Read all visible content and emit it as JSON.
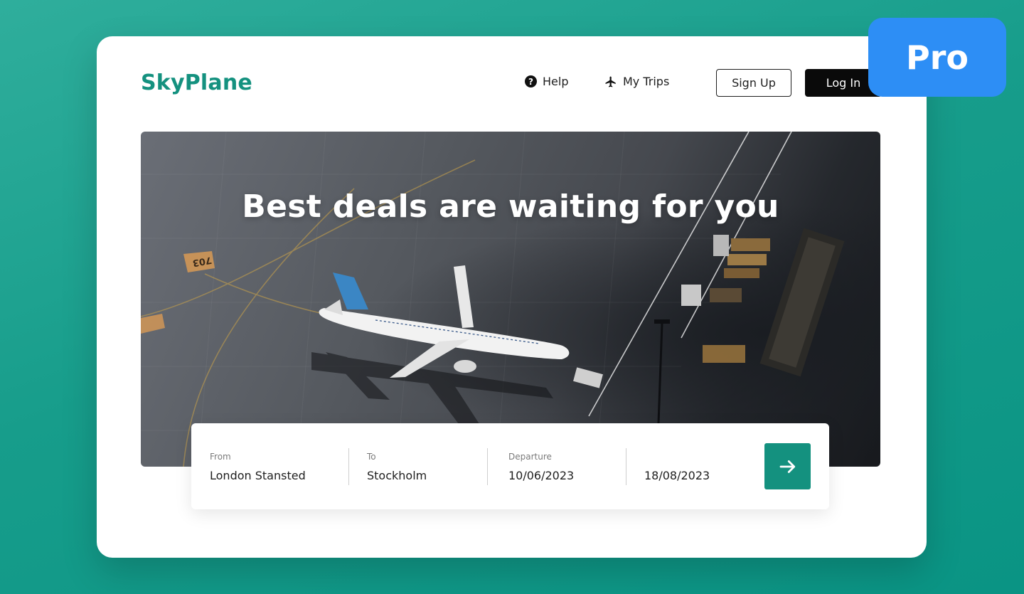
{
  "brand": {
    "name": "SkyPlane",
    "color": "#14917f"
  },
  "nav": {
    "help": {
      "label": "Help",
      "icon": "question-circle-icon"
    },
    "trips": {
      "label": "My Trips",
      "icon": "airplane-icon"
    },
    "sign_up": "Sign Up",
    "log_in": "Log In"
  },
  "hero": {
    "title": "Best deals are waiting for you",
    "image": "aerial-airport-with-airplane-photo",
    "stand_number": "703"
  },
  "search": {
    "from": {
      "label": "From",
      "value": "London Stansted"
    },
    "to": {
      "label": "To",
      "value": "Stockholm"
    },
    "departure": {
      "label": "Departure",
      "value": "10/06/2023"
    },
    "return": {
      "label": "",
      "value": "18/08/2023"
    },
    "submit_icon": "arrow-right-icon"
  },
  "badge": {
    "label": "Pro",
    "color": "#2d8ef5"
  },
  "colors": {
    "accent": "#14917f",
    "background": "#179d8b",
    "login_button": "#0a0a0a"
  }
}
